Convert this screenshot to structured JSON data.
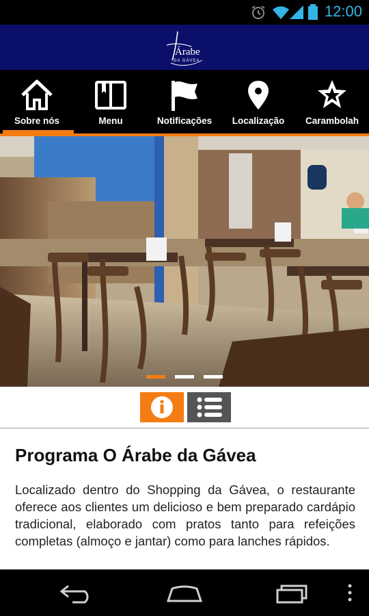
{
  "status_bar": {
    "time": "12:00",
    "icons": [
      "alarm-icon",
      "wifi-icon",
      "signal-icon",
      "battery-icon"
    ]
  },
  "app_bar": {
    "logo_text": "Árabe",
    "logo_subtext": "DA GÁVEA",
    "background": "#0a0f6a"
  },
  "tabs": [
    {
      "label": "Sobre nós",
      "icon": "home-icon",
      "active": true
    },
    {
      "label": "Menu",
      "icon": "book-icon",
      "active": false
    },
    {
      "label": "Notificações",
      "icon": "flag-icon",
      "active": false
    },
    {
      "label": "Localização",
      "icon": "location-pin-icon",
      "active": false
    },
    {
      "label": "Carambolah",
      "icon": "star-icon",
      "active": false
    }
  ],
  "accent_color": "#f47c12",
  "carousel": {
    "image": "restaurant-interior-photo",
    "page_count": 3,
    "active_index": 0
  },
  "toggles": {
    "info_icon": "info-icon",
    "list_icon": "list-icon"
  },
  "content": {
    "title": "Programa O Árabe da Gávea",
    "body": "Localizado dentro do Shopping da Gávea, o restaurante oferece aos clientes um delicioso e bem preparado cardápio tradicional, elaborado com pratos tanto para refeições completas (almoço e jantar) como para lanches rápidos."
  },
  "nav_bar": {
    "icons": [
      "back-icon",
      "home-icon",
      "recent-apps-icon",
      "overflow-menu-icon"
    ]
  }
}
